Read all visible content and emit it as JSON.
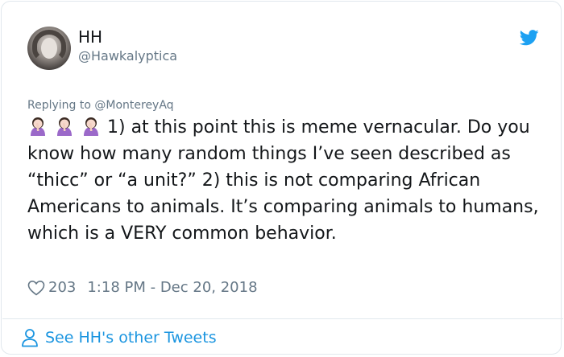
{
  "author": {
    "name": "HH",
    "handle": "@Hawkalyptica"
  },
  "reply_line": "Replying to @MontereyAq",
  "tweet": {
    "emoji": [
      "woman-facepalming",
      "woman-facepalming",
      "woman-facepalming"
    ],
    "text": "1) at this point this is meme vernacular. Do you know how many random things I’ve seen described as “thicc” or “a unit?” 2) this is not comparing African Americans to animals. It’s comparing animals to humans, which is a VERY common behavior."
  },
  "meta": {
    "likes": "203",
    "timestamp": "1:18 PM - Dec 20, 2018"
  },
  "footer": {
    "link_text": "See HH's other Tweets"
  },
  "colors": {
    "link": "#1b95e0",
    "muted": "#657786",
    "text": "#14171a",
    "border": "#e1e8ed"
  },
  "icons": {
    "brand": "twitter-bird-icon",
    "like": "heart-icon",
    "profile": "person-icon"
  }
}
